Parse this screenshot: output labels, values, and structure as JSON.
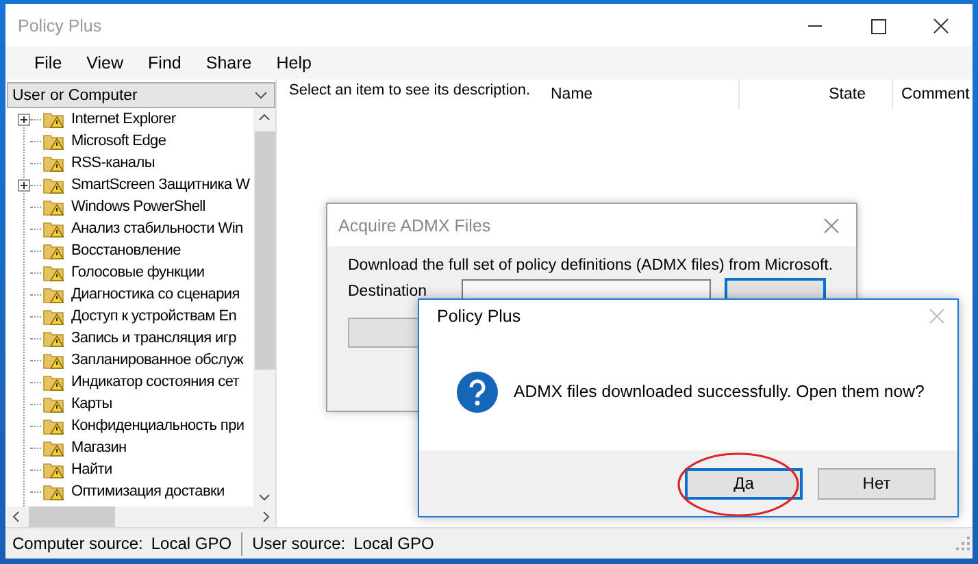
{
  "window": {
    "title": "Policy Plus"
  },
  "menu": [
    "File",
    "View",
    "Find",
    "Share",
    "Help"
  ],
  "left_panel": {
    "dropdown": "User or Computer",
    "tree": [
      {
        "label": "Internet Explorer",
        "kind": "group"
      },
      {
        "label": "Microsoft Edge",
        "kind": "leaf"
      },
      {
        "label": "RSS-каналы",
        "kind": "leaf"
      },
      {
        "label": "SmartScreen Защитника W",
        "kind": "group"
      },
      {
        "label": "Windows PowerShell",
        "kind": "leaf"
      },
      {
        "label": "Анализ стабильности Win",
        "kind": "leaf"
      },
      {
        "label": "Восстановление",
        "kind": "leaf"
      },
      {
        "label": "Голосовые функции",
        "kind": "leaf"
      },
      {
        "label": "Диагностика со сценария",
        "kind": "leaf"
      },
      {
        "label": "Доступ к устройствам En",
        "kind": "leaf"
      },
      {
        "label": "Запись и трансляция игр",
        "kind": "leaf"
      },
      {
        "label": "Запланированное обслуж",
        "kind": "leaf"
      },
      {
        "label": "Индикатор состояния сет",
        "kind": "leaf"
      },
      {
        "label": "Карты",
        "kind": "leaf"
      },
      {
        "label": "Конфиденциальность при",
        "kind": "leaf"
      },
      {
        "label": "Магазин",
        "kind": "leaf"
      },
      {
        "label": "Найти",
        "kind": "leaf"
      },
      {
        "label": "Оптимизация доставки",
        "kind": "leaf"
      }
    ]
  },
  "description": "Select an item to see its description.",
  "columns": [
    "Name",
    "State",
    "Comment"
  ],
  "acquire_dialog": {
    "title": "Acquire ADMX Files",
    "text": "Download the full set of policy definitions (ADMX files) from Microsoft.",
    "destination_label": "Destination"
  },
  "message_box": {
    "title": "Policy Plus",
    "message": "ADMX files downloaded successfully. Open them now?",
    "buttons": [
      {
        "label": "Да",
        "selected": true
      },
      {
        "label": "Нет",
        "selected": false
      }
    ]
  },
  "status_bar": [
    {
      "label": "Computer source:",
      "value": "Local GPO"
    },
    {
      "label": "User source:",
      "value": "Local GPO"
    }
  ]
}
